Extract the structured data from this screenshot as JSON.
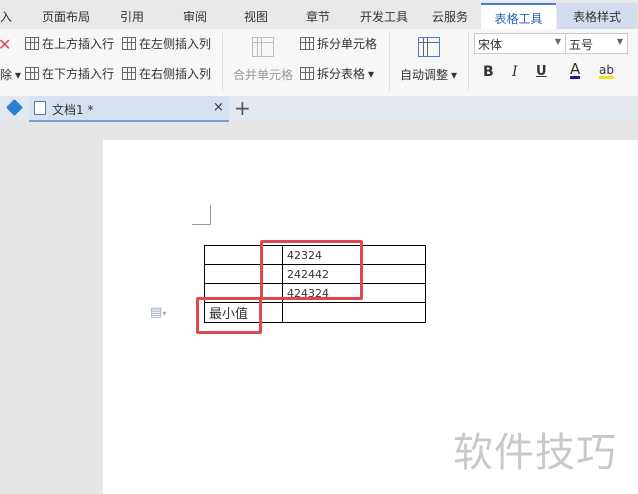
{
  "menu": {
    "items": [
      "入",
      "页面布局",
      "引用",
      "审阅",
      "视图",
      "章节",
      "开发工具",
      "云服务",
      "表格工具",
      "表格样式"
    ]
  },
  "ribbon": {
    "delete_label": "除",
    "insert_above": "在上方插入行",
    "insert_below": "在下方插入行",
    "insert_left": "在左侧插入列",
    "insert_right": "在右侧插入列",
    "merge_cells": "合并单元格",
    "split_cells": "拆分单元格",
    "split_table": "拆分表格",
    "auto_fit": "自动调整",
    "font_name": "宋体",
    "font_size": "五号",
    "bold": "B",
    "italic": "I",
    "underline": "U",
    "font_color": "A",
    "highlight": "ab"
  },
  "tabs": {
    "doc_title": "文档1 *",
    "close": "×",
    "new": "+"
  },
  "table": {
    "rows": [
      [
        "",
        "",
        "42324"
      ],
      [
        "",
        "",
        "242442"
      ],
      [
        "",
        "",
        "424324"
      ],
      [
        "最小值",
        "",
        ""
      ]
    ]
  },
  "watermark": "软件技巧",
  "colors": {
    "accent": "#2e62b8",
    "highlight_box": "#e0484f"
  }
}
